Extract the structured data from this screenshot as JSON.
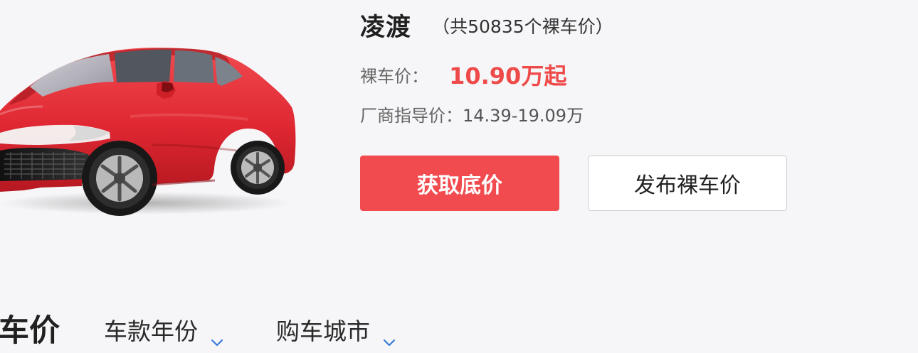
{
  "header": {
    "car_name": "凌渡",
    "count_text": "（共50835个裸车价）"
  },
  "pricing": {
    "price_label": "裸车价：",
    "price_value": "10.90万起",
    "guide_label": "厂商指导价：",
    "guide_value": "14.39-19.09万"
  },
  "actions": {
    "primary_label": "获取底价",
    "secondary_label": "发布裸车价"
  },
  "section": {
    "title": "车价"
  },
  "filters": [
    {
      "label": "车款年份",
      "icon": "chevron-down-icon"
    },
    {
      "label": "购车城市",
      "icon": "chevron-down-icon"
    }
  ],
  "colors": {
    "accent": "#f24b4f",
    "price": "#ef4a4a",
    "chevron": "#3b7ad8",
    "car_red": "#df2732"
  },
  "image": {
    "subject": "red sedan car image"
  }
}
